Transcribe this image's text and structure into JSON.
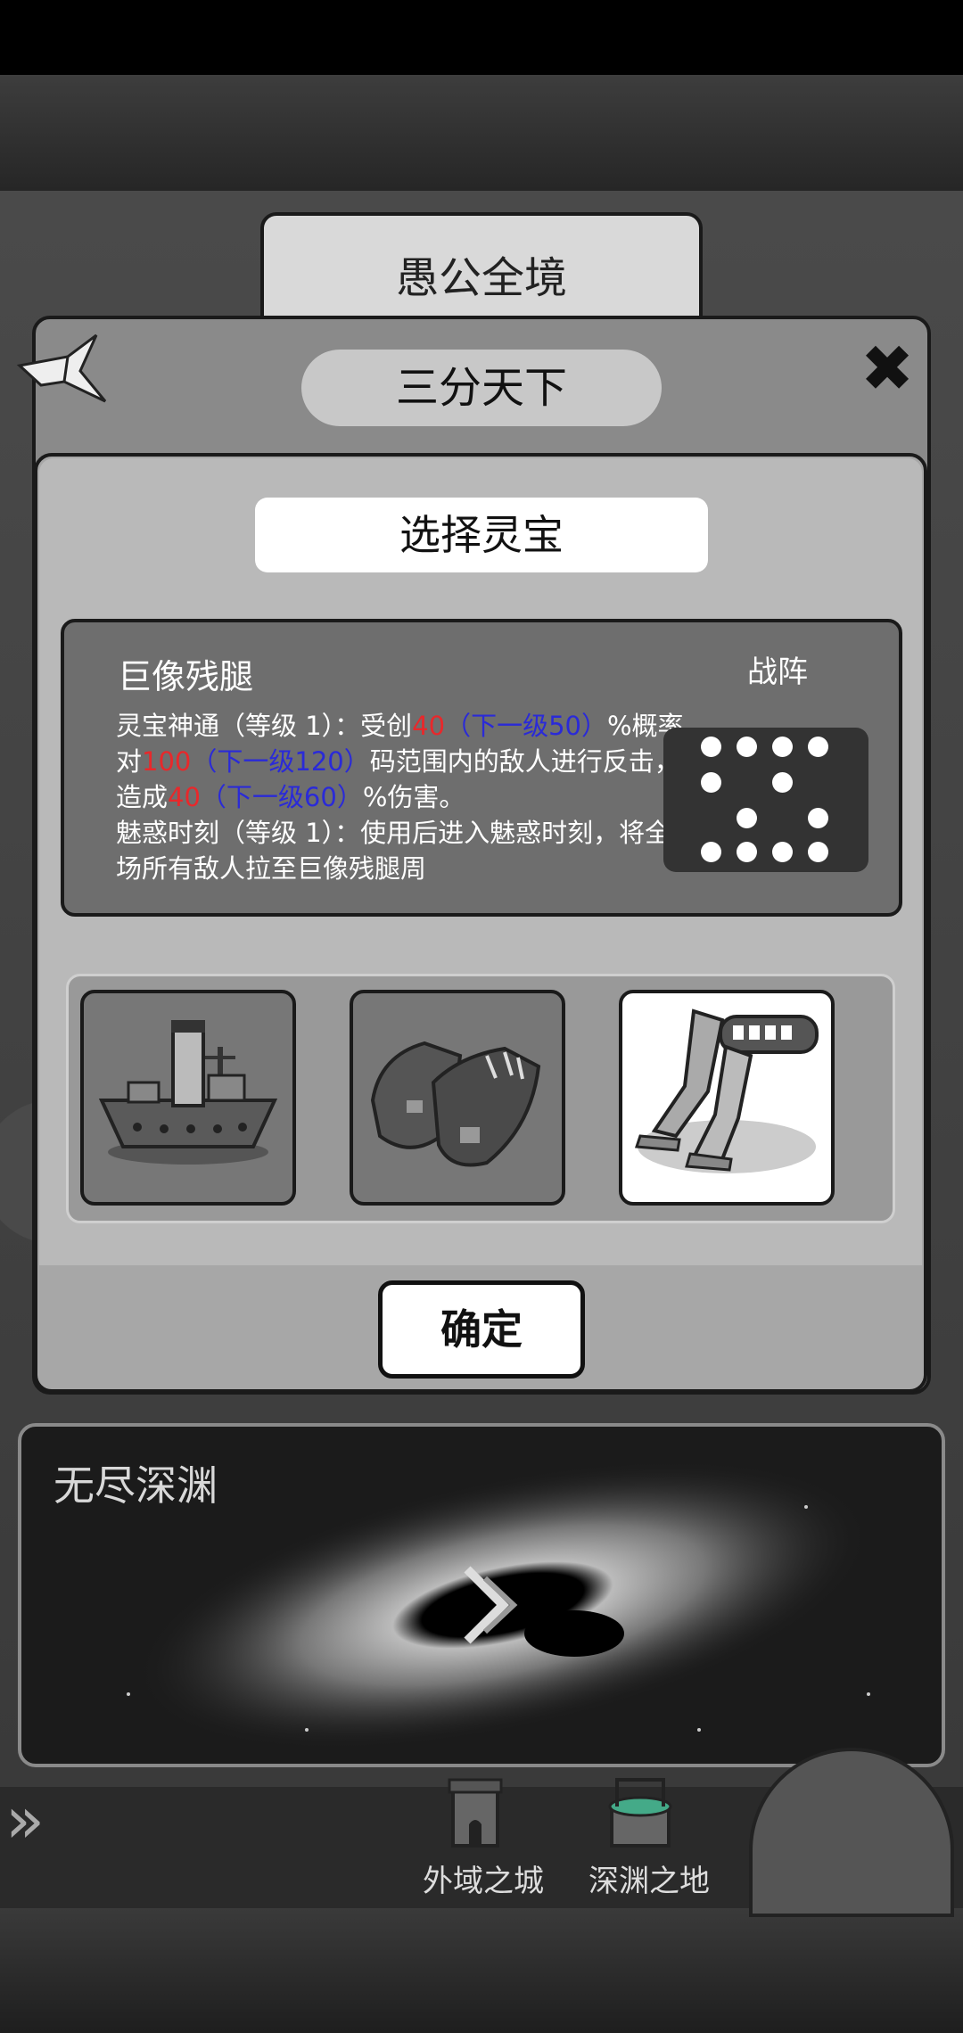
{
  "header": {
    "realm_tab": "愚公全境"
  },
  "dialog": {
    "title": "三分天下",
    "section_title": "选择灵宝",
    "confirm_label": "确定"
  },
  "item": {
    "name": "巨像残腿",
    "formation_label": "战阵",
    "desc": {
      "s1a": "灵宝神通（等级 1）：受创",
      "s1b": "40",
      "s1c": "（下一级50）",
      "s1d": "%概率对",
      "s1e": "100",
      "s1f": "（下一级120）",
      "s1g": "码范围内的敌人进行反击，造成",
      "s1h": "40",
      "s1i": "（下一级60）",
      "s1j": "%伤害。",
      "s2": "魅惑时刻（等级 1）：使用后进入魅惑时刻，将全场所有敌人拉至巨像残腿周"
    }
  },
  "choices": [
    {
      "name": "ship-relic",
      "selected": false
    },
    {
      "name": "boots-relic",
      "selected": false
    },
    {
      "name": "giant-legs-relic",
      "selected": true
    }
  ],
  "stage": {
    "name": "无尽深渊"
  },
  "bottom_nav": {
    "loc1": "外域之城",
    "loc2": "深渊之地"
  },
  "icons": {
    "close": "close-icon",
    "crane": "paper-crane-icon",
    "arrows": "double-chevron-right-icon"
  }
}
